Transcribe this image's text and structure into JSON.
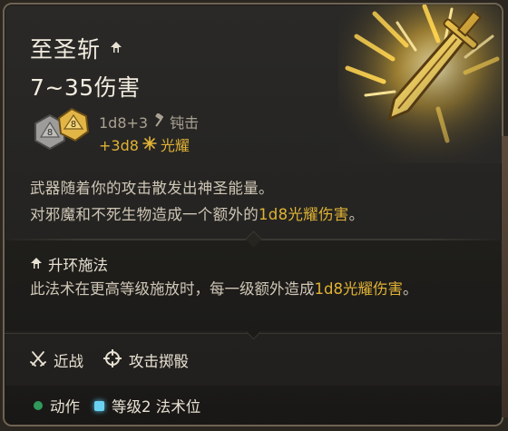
{
  "spell": {
    "name": "至圣斩",
    "damage_range": "7~35伤害"
  },
  "dice": {
    "grey_face": "8",
    "gold_face": "8"
  },
  "damage_lines": [
    {
      "formula": "1d8+3",
      "type": "钝击"
    },
    {
      "formula": "+3d8",
      "type": "光耀"
    }
  ],
  "description": {
    "line1": "武器随着你的攻击散发出神圣能量。",
    "line2_pre": "对邪魔和不死生物造成一个额外的",
    "line2_hl": "1d8光耀伤害",
    "line2_post": "。"
  },
  "upcast": {
    "title": "升环施法",
    "text_pre": "此法术在更高等级施放时，每一级额外造成",
    "text_hl": "1d8光耀伤害",
    "text_post": "。"
  },
  "properties": {
    "range_label": "近战",
    "roll_label": "攻击掷骰"
  },
  "costs": {
    "action_label": "动作",
    "slot_label": "等级2 法术位"
  },
  "colors": {
    "gold": "#e0b236",
    "action_green": "#2f9a5b",
    "slot_blue": "#6ad3f2"
  }
}
